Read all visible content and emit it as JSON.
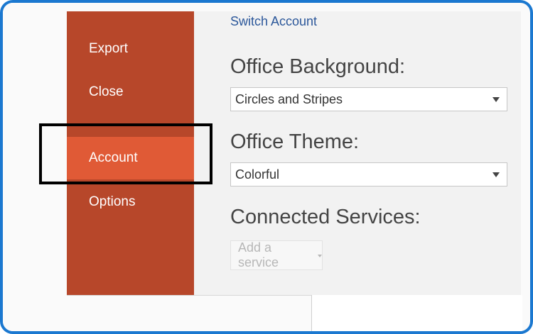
{
  "sidebar": {
    "items": [
      {
        "label": "Export",
        "active": false
      },
      {
        "label": "Close",
        "active": false
      },
      {
        "label": "Account",
        "active": true
      },
      {
        "label": "Options",
        "active": false
      }
    ]
  },
  "main": {
    "switch_account_label": "Switch Account",
    "background": {
      "heading": "Office Background:",
      "selected": "Circles and Stripes"
    },
    "theme": {
      "heading": "Office Theme:",
      "selected": "Colorful"
    },
    "services": {
      "heading": "Connected Services:",
      "add_label": "Add a service"
    }
  },
  "colors": {
    "sidebar": "#b7472a",
    "sidebar_active": "#e05a36",
    "link": "#2b579a",
    "frame_border": "#1b78d0",
    "highlight_box": "#000000"
  }
}
